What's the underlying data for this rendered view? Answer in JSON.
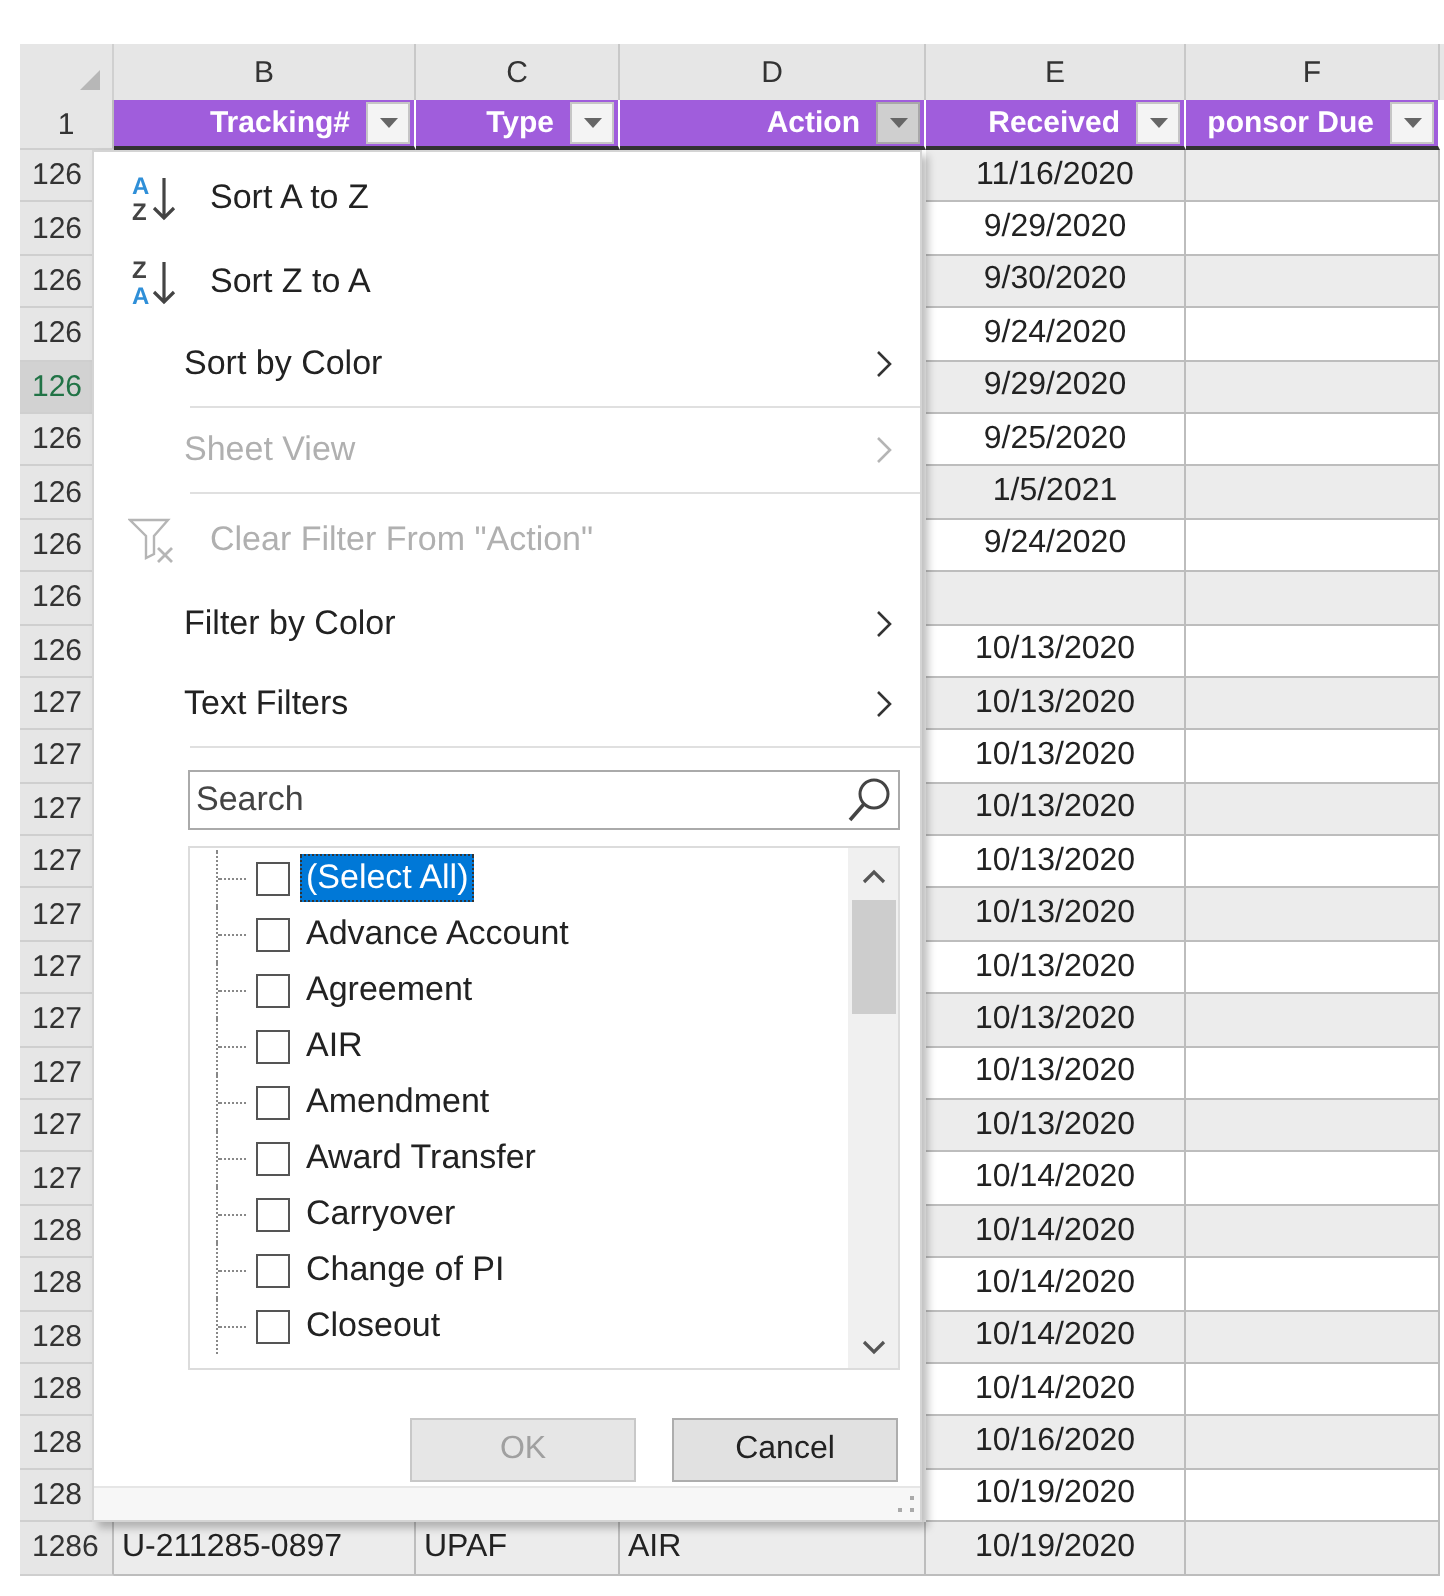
{
  "columns": [
    {
      "letter": "B"
    },
    {
      "letter": "C"
    },
    {
      "letter": "D"
    },
    {
      "letter": "E"
    },
    {
      "letter": "F"
    }
  ],
  "header_row": {
    "number": "1",
    "cells": [
      {
        "text": "Tracking#",
        "filter_open": false
      },
      {
        "text": "Type",
        "filter_open": false
      },
      {
        "text": "Action",
        "filter_open": true
      },
      {
        "text": "Received",
        "filter_open": false
      },
      {
        "text": "ponsor Due",
        "filter_open": false
      }
    ]
  },
  "rows": [
    {
      "number": "126",
      "selected": false,
      "received": "11/16/2020"
    },
    {
      "number": "126",
      "selected": false,
      "received": "9/29/2020"
    },
    {
      "number": "126",
      "selected": false,
      "received": "9/30/2020"
    },
    {
      "number": "126",
      "selected": false,
      "received": "9/24/2020"
    },
    {
      "number": "126",
      "selected": true,
      "received": "9/29/2020"
    },
    {
      "number": "126",
      "selected": false,
      "received": "9/25/2020"
    },
    {
      "number": "126",
      "selected": false,
      "received": "1/5/2021"
    },
    {
      "number": "126",
      "selected": false,
      "received": "9/24/2020"
    },
    {
      "number": "126",
      "selected": false
    },
    {
      "number": "126",
      "selected": false,
      "received": "10/13/2020"
    },
    {
      "number": "127",
      "selected": false,
      "received": "10/13/2020"
    },
    {
      "number": "127",
      "selected": false,
      "received": "10/13/2020"
    },
    {
      "number": "127",
      "selected": false,
      "received": "10/13/2020"
    },
    {
      "number": "127",
      "selected": false,
      "received": "10/13/2020"
    },
    {
      "number": "127",
      "selected": false,
      "received": "10/13/2020"
    },
    {
      "number": "127",
      "selected": false,
      "received": "10/13/2020"
    },
    {
      "number": "127",
      "selected": false,
      "received": "10/13/2020"
    },
    {
      "number": "127",
      "selected": false,
      "received": "10/13/2020"
    },
    {
      "number": "127",
      "selected": false,
      "received": "10/13/2020"
    },
    {
      "number": "127",
      "selected": false,
      "received": "10/14/2020"
    },
    {
      "number": "128",
      "selected": false,
      "received": "10/14/2020"
    },
    {
      "number": "128",
      "selected": false,
      "received": "10/14/2020"
    },
    {
      "number": "128",
      "selected": false,
      "received": "10/14/2020"
    },
    {
      "number": "128",
      "selected": false,
      "received": "10/14/2020"
    },
    {
      "number": "128",
      "selected": false,
      "received": "10/16/2020"
    },
    {
      "number": "128",
      "selected": false,
      "received": "10/19/2020"
    },
    {
      "number": "1286",
      "selected": false,
      "tracking": "U-211285-0897",
      "type": "UPAF",
      "action": "AIR",
      "received": "10/19/2020"
    }
  ],
  "filter_menu": {
    "items": [
      {
        "kind": "sort_asc",
        "label": "Sort A to Z",
        "icon_letters": [
          "A",
          "Z"
        ],
        "disabled": false
      },
      {
        "kind": "sort_desc",
        "label": "Sort Z to A",
        "icon_letters": [
          "Z",
          "A"
        ],
        "disabled": false
      },
      {
        "kind": "submenu",
        "label": "Sort by Color",
        "disabled": false
      },
      {
        "kind": "separator"
      },
      {
        "kind": "submenu",
        "label": "Sheet View",
        "disabled": true
      },
      {
        "kind": "separator"
      },
      {
        "kind": "clear_filter",
        "label": "Clear Filter From \"Action\"",
        "disabled": true
      },
      {
        "kind": "submenu",
        "label": "Filter by Color",
        "disabled": false
      },
      {
        "kind": "submenu",
        "label": "Text Filters",
        "disabled": false
      },
      {
        "kind": "separator"
      }
    ],
    "search": {
      "placeholder": "Search"
    },
    "values": [
      {
        "label": "(Select All)",
        "checked": false,
        "selected": true
      },
      {
        "label": "Advance Account",
        "checked": false,
        "selected": false
      },
      {
        "label": "Agreement",
        "checked": false,
        "selected": false
      },
      {
        "label": "AIR",
        "checked": false,
        "selected": false
      },
      {
        "label": "Amendment",
        "checked": false,
        "selected": false
      },
      {
        "label": "Award Transfer",
        "checked": false,
        "selected": false
      },
      {
        "label": "Carryover",
        "checked": false,
        "selected": false
      },
      {
        "label": "Change of PI",
        "checked": false,
        "selected": false
      },
      {
        "label": "Closeout",
        "checked": false,
        "selected": false
      }
    ],
    "buttons": [
      {
        "label": "OK",
        "disabled": true
      },
      {
        "label": "Cancel",
        "disabled": false
      }
    ]
  }
}
